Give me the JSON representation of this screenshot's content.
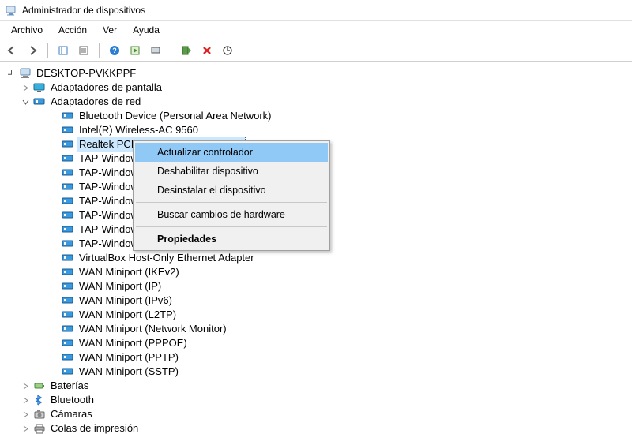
{
  "window": {
    "title": "Administrador de dispositivos"
  },
  "menu": {
    "file": "Archivo",
    "action": "Acción",
    "view": "Ver",
    "help": "Ayuda"
  },
  "tree": {
    "root": "DESKTOP-PVKKPPF",
    "categories": [
      {
        "name": "Adaptadores de pantalla",
        "expanded": false
      },
      {
        "name": "Adaptadores de red",
        "expanded": true,
        "children": [
          "Bluetooth Device (Personal Area Network)",
          "Intel(R) Wireless-AC 9560",
          "Realtek PCIe GbE Family Controller",
          "TAP-Windows",
          "TAP-Windows",
          "TAP-Windows",
          "TAP-Windows",
          "TAP-Windows",
          "TAP-Windows",
          "TAP-Windows",
          "VirtualBox Host-Only Ethernet Adapter",
          "WAN Miniport (IKEv2)",
          "WAN Miniport (IP)",
          "WAN Miniport (IPv6)",
          "WAN Miniport (L2TP)",
          "WAN Miniport (Network Monitor)",
          "WAN Miniport (PPPOE)",
          "WAN Miniport (PPTP)",
          "WAN Miniport (SSTP)"
        ]
      },
      {
        "name": "Baterías",
        "expanded": false
      },
      {
        "name": "Bluetooth",
        "expanded": false
      },
      {
        "name": "Cámaras",
        "expanded": false
      },
      {
        "name": "Colas de impresión",
        "expanded": false
      }
    ]
  },
  "context_menu": {
    "update_driver": "Actualizar controlador",
    "disable_device": "Deshabilitar dispositivo",
    "uninstall_device": "Desinstalar el dispositivo",
    "scan_hw": "Buscar cambios de hardware",
    "properties": "Propiedades"
  }
}
